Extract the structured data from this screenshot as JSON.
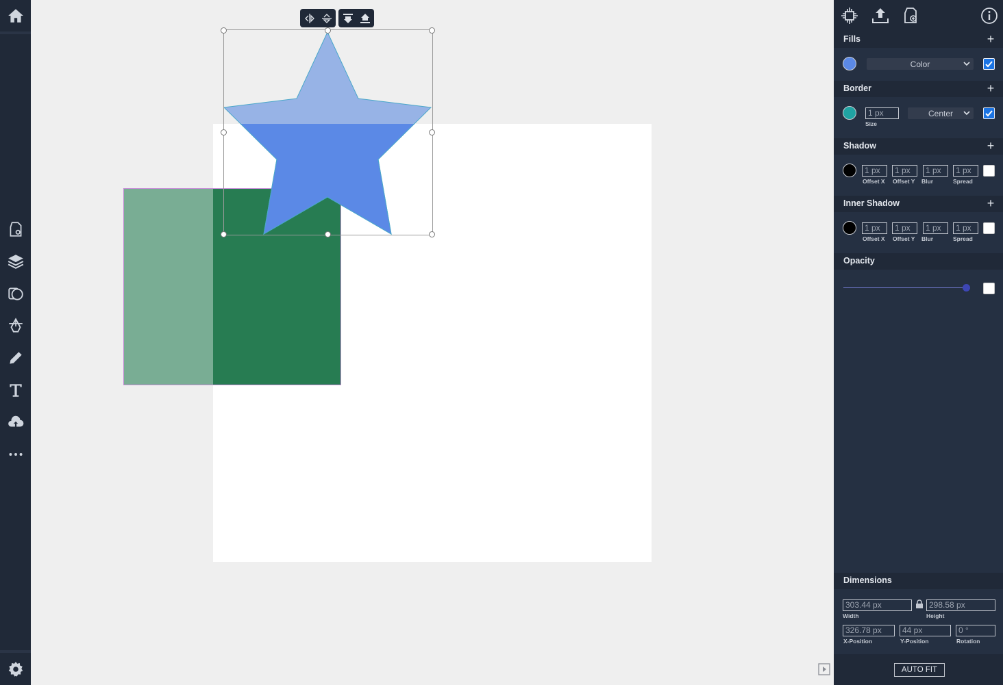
{
  "left_toolbar": {
    "items": [
      "home-icon",
      "page-settings-icon",
      "layers-icon",
      "shapes-icon",
      "pen-tool-icon",
      "pencil-icon",
      "text-icon",
      "cloud-upload-icon",
      "more-icon",
      "settings-icon"
    ]
  },
  "float_toolbar": {
    "buttons": [
      "flip-horizontal-icon",
      "flip-vertical-icon",
      "bring-to-front-icon",
      "send-to-back-icon"
    ]
  },
  "canvas": {
    "colors": {
      "artboard": "#ffffff",
      "rect_light": "#79ad94",
      "rect_dark": "#277c52",
      "star_fill": "#5b89e6",
      "star_outside": "#97b3e6"
    }
  },
  "panel": {
    "top_icons": [
      "circuit-icon",
      "upload-icon",
      "page-add-icon",
      "info-icon"
    ],
    "fills": {
      "title": "Fills",
      "add": "+",
      "color": "#5b89e6",
      "type": "Color",
      "enabled": true
    },
    "border": {
      "title": "Border",
      "add": "+",
      "color": "#20a3a3",
      "size": "1 px",
      "size_label": "Size",
      "position": "Center",
      "enabled": true
    },
    "shadow": {
      "title": "Shadow",
      "add": "+",
      "color": "#000000",
      "offset_x": "1 px",
      "offset_y": "1 px",
      "blur": "1 px",
      "spread": "1 px",
      "labels": {
        "offset_x": "Offset X",
        "offset_y": "Offset Y",
        "blur": "Blur",
        "spread": "Spread"
      },
      "enabled": false
    },
    "inner_shadow": {
      "title": "Inner Shadow",
      "add": "+",
      "color": "#000000",
      "offset_x": "1 px",
      "offset_y": "1 px",
      "blur": "1 px",
      "spread": "1 px",
      "labels": {
        "offset_x": "Offset X",
        "offset_y": "Offset Y",
        "blur": "Blur",
        "spread": "Spread"
      },
      "enabled": false
    },
    "opacity": {
      "title": "Opacity",
      "value_fraction": 1.0,
      "enabled": false
    },
    "dimensions": {
      "title": "Dimensions",
      "width": "303.44 px",
      "width_label": "Width",
      "height": "298.58 px",
      "height_label": "Height",
      "x": "326.78 px",
      "x_label": "X-Position",
      "y": "44 px",
      "y_label": "Y-Position",
      "rotation": "0 °",
      "rotation_label": "Rotation",
      "auto_fit": "AUTO FIT"
    }
  }
}
